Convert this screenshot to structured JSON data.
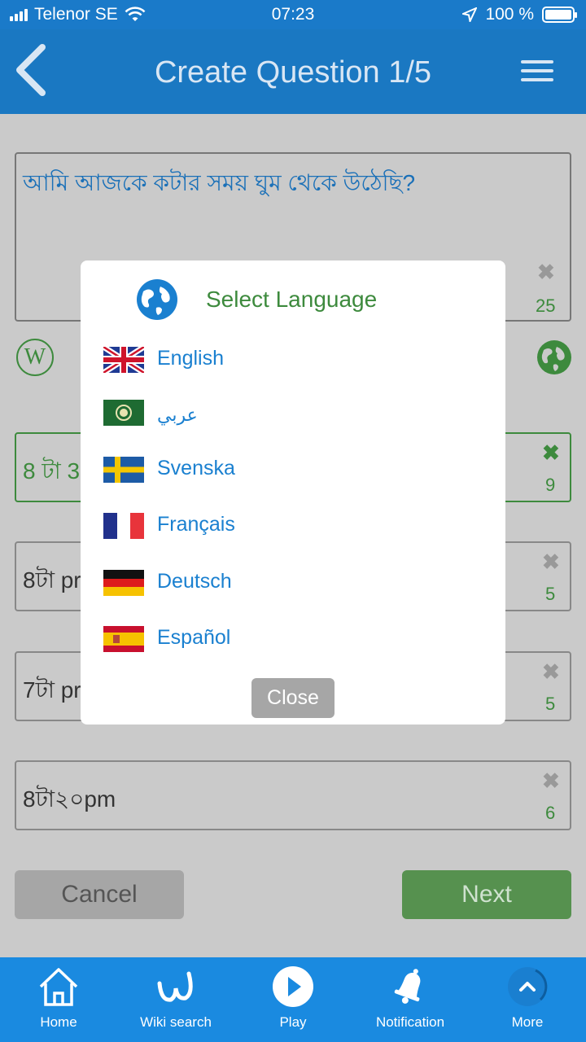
{
  "status_bar": {
    "carrier": "Telenor SE",
    "time": "07:23",
    "battery": "100 %"
  },
  "header": {
    "title": "Create Question 1/5"
  },
  "question": {
    "text": "আমি আজকে কটার সময় ঘুম থেকে উঠেছি?",
    "count": "25"
  },
  "answers": [
    {
      "text": "8 টা 3",
      "count": "9",
      "correct": true
    },
    {
      "text": "8টা pr",
      "count": "5",
      "correct": false
    },
    {
      "text": "7টা pr",
      "count": "5",
      "correct": false
    },
    {
      "text": "8টা২০pm",
      "count": "6",
      "correct": false
    }
  ],
  "buttons": {
    "cancel": "Cancel",
    "next": "Next"
  },
  "modal": {
    "title": "Select Language",
    "languages": [
      {
        "name": "English",
        "flag": "uk-flag-icon"
      },
      {
        "name": "عربي",
        "flag": "arab-league-flag-icon"
      },
      {
        "name": "Svenska",
        "flag": "sweden-flag-icon"
      },
      {
        "name": "Français",
        "flag": "france-flag-icon"
      },
      {
        "name": "Deutsch",
        "flag": "germany-flag-icon"
      },
      {
        "name": "Español",
        "flag": "spain-flag-icon"
      }
    ],
    "close": "Close"
  },
  "tabbar": [
    {
      "label": "Home",
      "icon": "home-icon"
    },
    {
      "label": "Wiki search",
      "icon": "wiki-search-icon"
    },
    {
      "label": "Play",
      "icon": "play-icon"
    },
    {
      "label": "Notification",
      "icon": "bell-icon"
    },
    {
      "label": "More",
      "icon": "more-icon"
    }
  ],
  "colors": {
    "header": "#1a78c2",
    "tabbar": "#1a8ae0",
    "accent_green": "#3d8a3d",
    "link_blue": "#1a80d0"
  }
}
